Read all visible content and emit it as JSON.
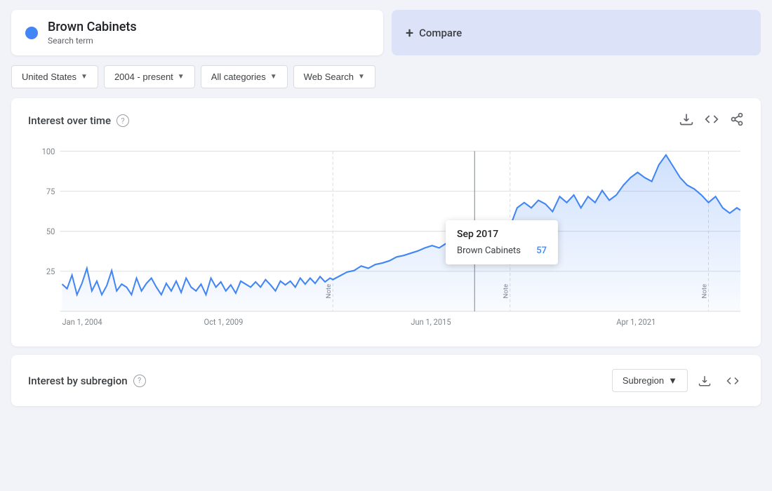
{
  "search_term": {
    "title": "Brown Cabinets",
    "subtitle": "Search term",
    "dot_color": "#4285f4"
  },
  "compare": {
    "label": "Compare",
    "plus_symbol": "+"
  },
  "filters": [
    {
      "id": "location",
      "label": "United States",
      "has_chevron": true
    },
    {
      "id": "time",
      "label": "2004 - present",
      "has_chevron": true
    },
    {
      "id": "category",
      "label": "All categories",
      "has_chevron": true
    },
    {
      "id": "search_type",
      "label": "Web Search",
      "has_chevron": true
    }
  ],
  "chart": {
    "title": "Interest over time",
    "help_label": "?",
    "actions": {
      "download_icon": "⬇",
      "embed_icon": "<>",
      "share_icon": "⤴"
    },
    "x_labels": [
      "Jan 1, 2004",
      "Oct 1, 2009",
      "Jun 1, 2015",
      "Apr 1, 2021"
    ],
    "y_labels": [
      "100",
      "75",
      "50",
      "25"
    ],
    "note_labels": [
      "Note",
      "Note",
      "Note"
    ],
    "tooltip": {
      "date": "Sep 2017",
      "term": "Brown Cabinets",
      "value": "57"
    }
  },
  "bottom_section": {
    "title": "Interest by subregion",
    "help_label": "?",
    "subregion_label": "Subregion",
    "download_icon": "⬇",
    "embed_icon": "<>"
  }
}
